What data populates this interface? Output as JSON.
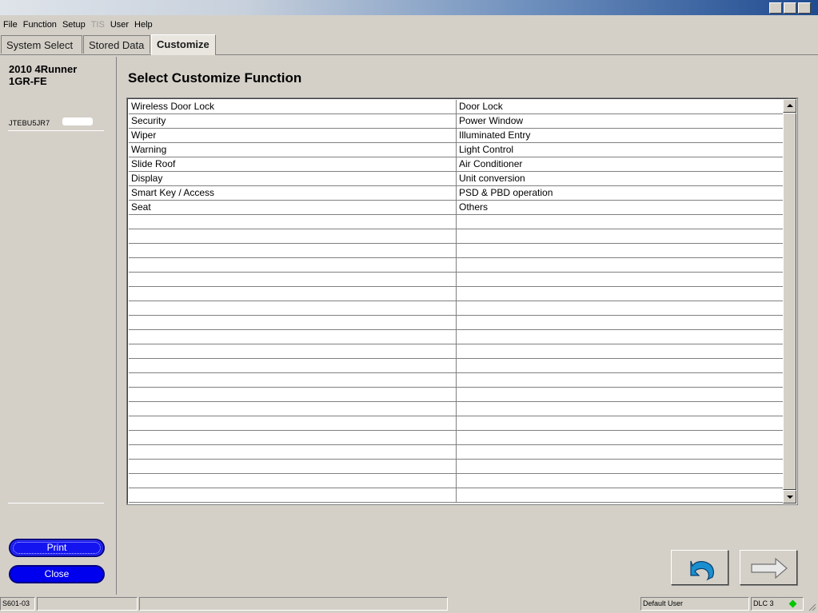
{
  "menubar": {
    "items": [
      {
        "label": "File",
        "enabled": true
      },
      {
        "label": "Function",
        "enabled": true
      },
      {
        "label": "Setup",
        "enabled": true
      },
      {
        "label": "TIS",
        "enabled": false
      },
      {
        "label": "User",
        "enabled": true
      },
      {
        "label": "Help",
        "enabled": true
      }
    ]
  },
  "tabs": [
    {
      "label": "System Select",
      "active": false
    },
    {
      "label": "Stored Data",
      "active": false
    },
    {
      "label": "Customize",
      "active": true
    }
  ],
  "sidebar": {
    "vehicle_model": "2010 4Runner",
    "engine": "1GR-FE",
    "vin_partial": "JTEBU5JR7",
    "print_label": "Print",
    "close_label": "Close"
  },
  "main": {
    "title": "Select Customize Function",
    "functions_left": [
      "Wireless Door Lock",
      "Security",
      "Wiper",
      "Warning",
      "Slide Roof",
      "Display",
      "Smart Key / Access",
      "Seat"
    ],
    "functions_right": [
      "Door Lock",
      "Power Window",
      "Illuminated Entry",
      "Light Control",
      "Air Conditioner",
      "Unit conversion",
      "PSD & PBD operation",
      "Others"
    ],
    "total_rows": 28
  },
  "buttons": {
    "back_icon": "back-arrow-icon",
    "next_icon": "next-arrow-icon"
  },
  "statusbar": {
    "screen_code": "S601-03",
    "user": "Default User",
    "connection": "DLC 3"
  },
  "colors": {
    "pill_button": "#0000ee",
    "back_arrow": "#1a8fd0",
    "status_led": "#00c800"
  }
}
